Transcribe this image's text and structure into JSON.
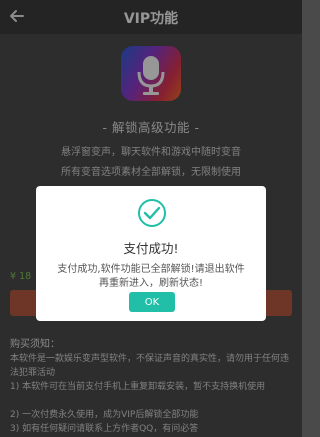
{
  "header": {
    "title": "VIP功能",
    "back_icon": "arrow-left-icon"
  },
  "app": {
    "icon": "microphone-icon"
  },
  "section": {
    "title": "- 解锁高级功能 -",
    "features": [
      "悬浮窗变声，聊天软件和游戏中随时变音",
      "所有变音选项素材全部解锁，无限制使用"
    ]
  },
  "purchase": {
    "price_visible": "¥ 18"
  },
  "notice": {
    "title": "购买须知：",
    "lines": [
      "本软件是一款娱乐变声型软件，不保证声音的真实性，请勿用于任何违法犯罪活动",
      "1) 本软件可在当前支付手机上重复卸载安装，暂不支持换机使用",
      "2) 一次付费永久使用，成为VIP后解锁全部功能",
      "3) 如有任何疑问请联系上方作者QQ，有问必答"
    ]
  },
  "dialog": {
    "icon": "check-icon",
    "title": "支付成功!",
    "message": "支付成功,软件功能已全部解锁!请退出软件再重新进入，刷新状态!",
    "ok_label": "OK",
    "accent_color": "#21bfa7"
  }
}
